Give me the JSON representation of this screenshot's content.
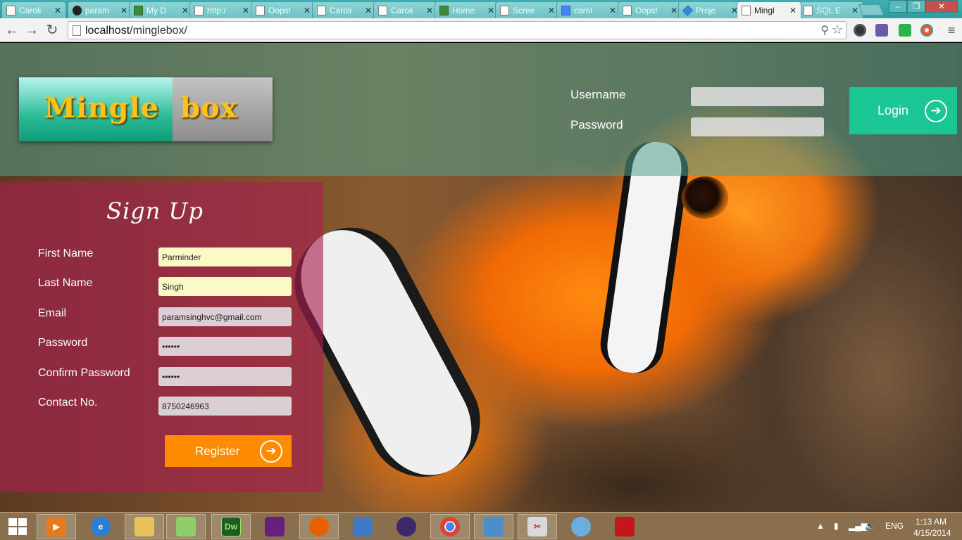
{
  "browser": {
    "tabs": [
      {
        "label": "Caroli",
        "icon": "page-icon"
      },
      {
        "label": "param",
        "icon": "github-icon"
      },
      {
        "label": "My D",
        "icon": "ibm-icon"
      },
      {
        "label": "http:/",
        "icon": "page-icon"
      },
      {
        "label": "Oops!",
        "icon": "page-icon"
      },
      {
        "label": "Caroli",
        "icon": "page-icon"
      },
      {
        "label": "Caroli",
        "icon": "page-icon"
      },
      {
        "label": "Home",
        "icon": "ibm-icon"
      },
      {
        "label": "Scree",
        "icon": "page-icon"
      },
      {
        "label": "carol",
        "icon": "google-icon"
      },
      {
        "label": "Oops!",
        "icon": "page-icon"
      },
      {
        "label": "Proje",
        "icon": "dropbox-icon"
      },
      {
        "label": "Mingl",
        "icon": "page-icon",
        "active": true
      },
      {
        "label": "SQL E",
        "icon": "page-icon"
      }
    ],
    "url_host": "localhost",
    "url_path": "/minglebox/"
  },
  "header": {
    "logo_text": "Mingle  box",
    "username_label": "Username",
    "password_label": "Password",
    "login_label": "Login"
  },
  "signup": {
    "title": "Sign Up",
    "fields": [
      {
        "label": "First Name",
        "value": "Parminder"
      },
      {
        "label": "Last Name",
        "value": "Singh"
      },
      {
        "label": "Email",
        "value": "paramsinghvc@gmail.com"
      },
      {
        "label": "Password",
        "value": "••••••"
      },
      {
        "label": "Confirm Password",
        "value": "••••••"
      },
      {
        "label": "Contact No.",
        "value": "8750246963"
      }
    ],
    "register_label": "Register"
  },
  "taskbar": {
    "apps": [
      "media-player-icon",
      "internet-explorer-icon",
      "file-explorer-icon",
      "notepad-plus-icon",
      "dreamweaver-icon",
      "visual-studio-icon",
      "firefox-icon",
      "virtualbox-icon",
      "eclipse-icon",
      "chrome-icon",
      "photos-icon",
      "snipping-tool-icon",
      "pidgin-icon",
      "acrobat-icon"
    ],
    "dreamweaver_text": "Dw",
    "language": "ENG",
    "time": "1:13 AM",
    "date": "4/15/2014"
  }
}
